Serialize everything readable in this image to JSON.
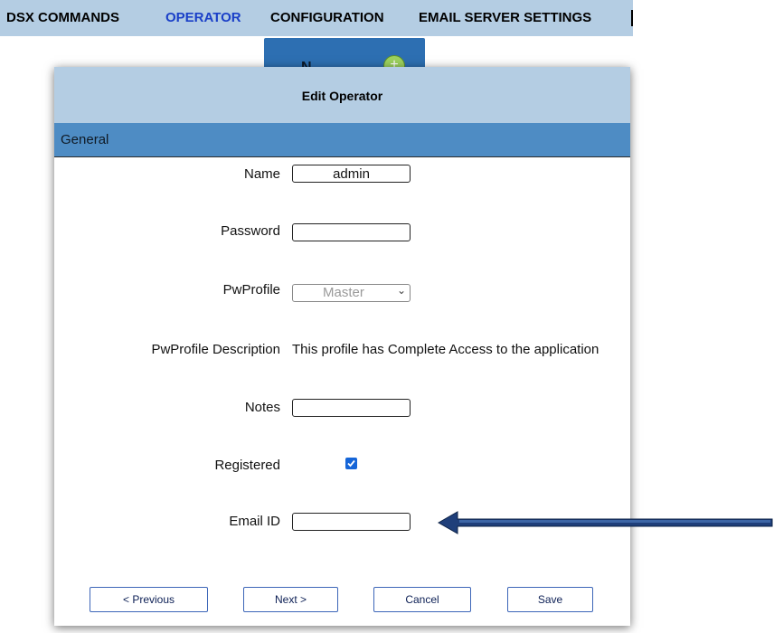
{
  "nav": {
    "items": [
      {
        "label": "DSX COMMANDS",
        "active": false
      },
      {
        "label": "OPERATOR",
        "active": true
      },
      {
        "label": "CONFIGURATION",
        "active": false
      },
      {
        "label": "EMAIL SERVER SETTINGS",
        "active": false
      }
    ],
    "background_tab_label": "N"
  },
  "dialog": {
    "title": "Edit Operator",
    "section": "General",
    "fields": {
      "name": {
        "label": "Name",
        "value": "admin"
      },
      "password": {
        "label": "Password",
        "value": ""
      },
      "pwprofile": {
        "label": "PwProfile",
        "value": "Master"
      },
      "pwprofile_description": {
        "label": "PwProfile Description",
        "value": "This profile has Complete Access to the application"
      },
      "notes": {
        "label": "Notes",
        "value": ""
      },
      "registered": {
        "label": "Registered",
        "checked": true
      },
      "email_id": {
        "label": "Email ID",
        "value": ""
      }
    },
    "buttons": {
      "previous": "< Previous",
      "next": "Next >",
      "cancel": "Cancel",
      "save": "Save"
    }
  },
  "colors": {
    "nav_bg": "#b4cde3",
    "section_bar": "#4e8cc4",
    "active_nav": "#1a3fc8",
    "annotation_arrow": "#1f3f7a"
  }
}
